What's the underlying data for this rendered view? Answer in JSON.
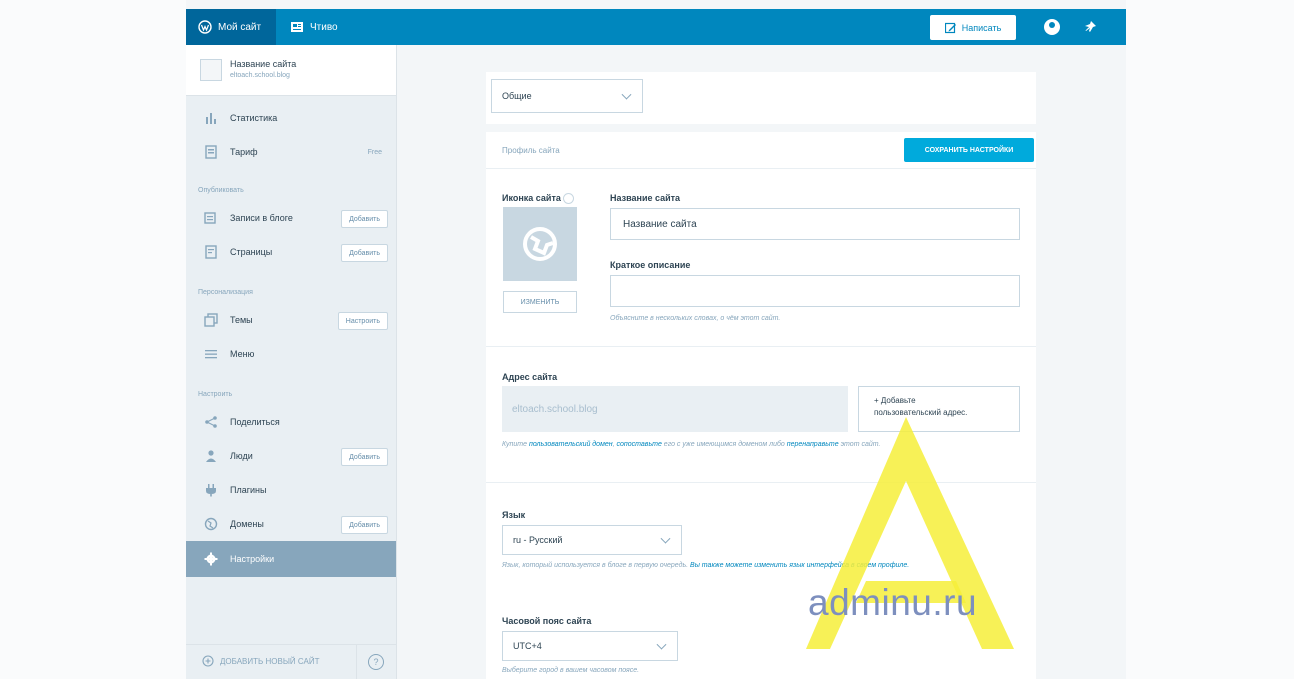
{
  "masterbar": {
    "my_site": "Мой сайт",
    "reader": "Чтиво",
    "write": "Написать"
  },
  "sidebar": {
    "site_name": "Название сайта",
    "site_url": "eltoach.school.blog",
    "stats": "Статистика",
    "plan": "Тариф",
    "plan_value": "Free",
    "publish_head": "Опубликовать",
    "posts": "Записи в блоге",
    "pages": "Страницы",
    "add": "Добавить",
    "personalize_head": "Персонализация",
    "themes": "Темы",
    "customize": "Настроить",
    "menus": "Меню",
    "configure_head": "Настроить",
    "sharing": "Поделиться",
    "people": "Люди",
    "plugins": "Плагины",
    "domains": "Домены",
    "settings": "Настройки",
    "add_new_site": "ДОБАВИТЬ НОВЫЙ САЙТ",
    "help": "?"
  },
  "main": {
    "section_select": "Общие",
    "profile_header": "Профиль сайта",
    "save_button": "СОХРАНИТЬ НАСТРОЙКИ",
    "site_icon_label": "Иконка сайта",
    "change_button": "ИЗМЕНИТЬ",
    "site_title_label": "Название сайта",
    "site_title_value": "Название сайта",
    "tagline_label": "Краткое описание",
    "tagline_value": "",
    "tagline_hint": "Объясните в нескольких словах, о чём этот сайт.",
    "address_label": "Адрес сайта",
    "address_value": "eltoach.school.blog",
    "add_address_line1": "+ Добавьте",
    "add_address_line2": "пользовательский адрес.",
    "address_hint_pre": "Купите ",
    "address_hint_link1": "пользовательский домен",
    "address_hint_mid": ", ",
    "address_hint_link2": "сопоставьте",
    "address_hint_post": " его с уже имеющимся доменом либо ",
    "address_hint_link3": "перенаправьте",
    "address_hint_end": " этот сайт.",
    "language_label": "Язык",
    "language_value": "ru - Русский",
    "language_hint_pre": "Язык, который используется в блоге в первую очередь. ",
    "language_hint_link": "Вы также можете изменить язык интерфейса в своем профиле.",
    "timezone_label": "Часовой пояс сайта",
    "timezone_value": "UTC+4",
    "timezone_hint": "Выберите город в вашем часовом поясе."
  },
  "watermark": {
    "text": "adminu.ru"
  },
  "colors": {
    "masterbar": "#0087be",
    "accent": "#00aadc",
    "sidebar_active": "#87a6bc"
  }
}
